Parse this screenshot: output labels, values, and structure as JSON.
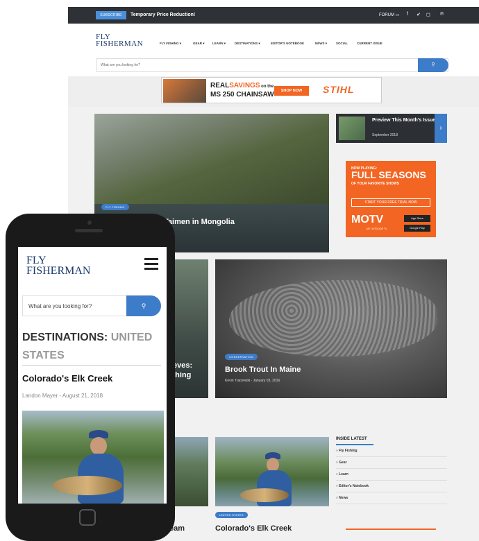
{
  "desktop": {
    "topbar": {
      "subscribe_label": "SUBSCRIBE",
      "promo_text": "Temporary Price Reduction!",
      "forum_label": "FORUM",
      "social_icons": [
        "facebook-icon",
        "twitter-icon",
        "instagram-icon",
        "pinterest-icon"
      ]
    },
    "logo": {
      "line1": "FLY",
      "line2": "FISHERMAN"
    },
    "nav": {
      "items": [
        "FLY FISHING ▾",
        "GEAR ▾",
        "LEARN ▾",
        "DESTINATIONS ▾",
        "EDITOR'S NOTEBOOK",
        "NEWS ▾",
        "SOCIAL",
        "CURRENT ISSUE"
      ]
    },
    "search": {
      "placeholder": "What are you looking for?"
    },
    "ad": {
      "line1_prefix": "REAL",
      "line1_highlight": "SAVINGS",
      "line1_suffix": " on the",
      "line2": "MS 250 CHAINSAW",
      "button": "SHOP NOW",
      "brand": "STIHL"
    },
    "hero": {
      "tag": "FLY FISHING",
      "title": "Taimen in Mongolia",
      "byline": "a"
    },
    "preview": {
      "title": "Preview This Month's Issue",
      "date": "September 2018"
    },
    "motv": {
      "now_playing": "NOW PLAYING:",
      "headline": "FULL SEASONS",
      "sub": "OF YOUR FAVORITE SHOWS",
      "cta": "START YOUR FREE TRIAL NOW",
      "brand": "MOTV",
      "brand_sub": "MY OUTDOOR TV",
      "store1": "App Store",
      "store2": "Google Play"
    },
    "card_left": {
      "title_line1": "ieves:",
      "title_line2": "ching"
    },
    "trout": {
      "tag": "CONSERVATION",
      "title": "Brook Trout In Maine",
      "byline": "Kevin Tracewski - January 03, 2016"
    },
    "row3": {
      "tag": "UNITED STATES",
      "title": "Colorado's Elk Creek",
      "left_title": "eam"
    },
    "inside_latest": {
      "heading": "INSIDE LATEST",
      "items": [
        "Fly Fishing",
        "Gear",
        "Learn",
        "Editor's Notebook",
        "News"
      ]
    }
  },
  "mobile": {
    "logo": {
      "line1": "FLY",
      "line2": "FISHERMAN"
    },
    "search": {
      "placeholder": "What are you looking for?"
    },
    "heading_dark": "DESTINATIONS: ",
    "heading_gray1": "UNITED",
    "heading_gray2": "STATES",
    "article_title": "Colorado's Elk Creek",
    "byline": "Landon Mayer - August 21, 2018"
  },
  "colors": {
    "accent": "#3d7cc9",
    "dark_bar": "#2e3136",
    "orange": "#f26522",
    "logo_navy": "#1b3a6b"
  }
}
